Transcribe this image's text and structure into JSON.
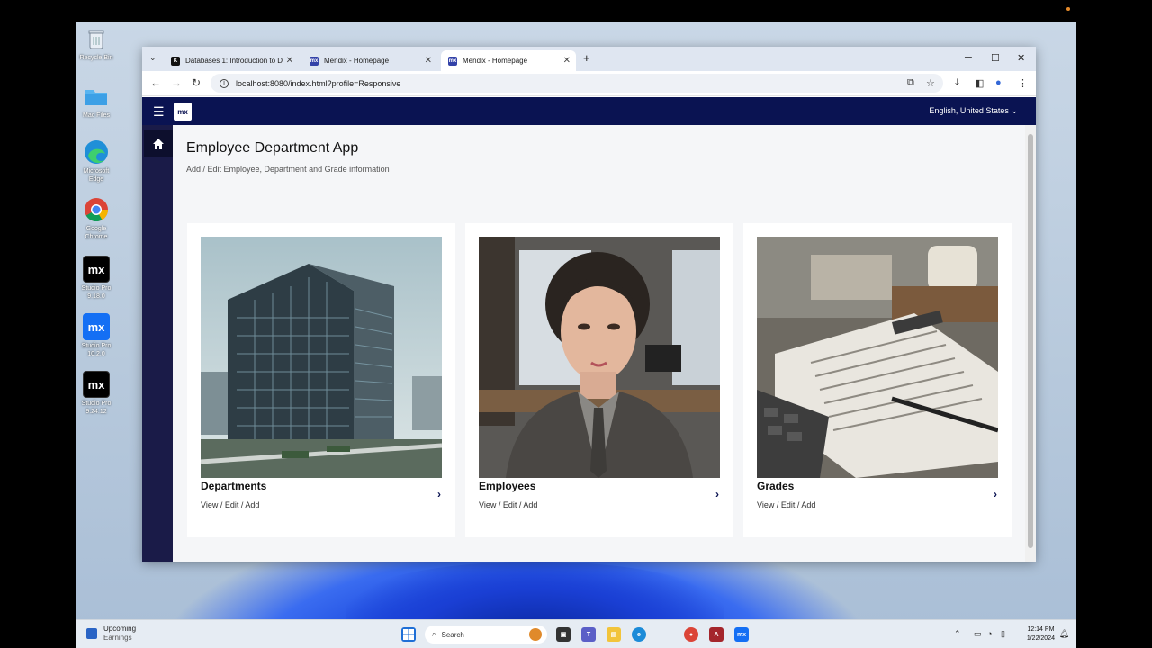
{
  "desktop": {
    "icons": [
      {
        "label": "Recycle Bin",
        "icon": "recycle-bin-icon"
      },
      {
        "label": "Mac Files",
        "icon": "folder-icon"
      },
      {
        "label": "Microsoft\nEdge",
        "icon": "edge-icon"
      },
      {
        "label": "Google\nChrome",
        "icon": "chrome-icon"
      },
      {
        "label": "Studio Pro\n9.18.0",
        "icon": "mx-icon",
        "glyph": "mx"
      },
      {
        "label": "Studio Pro\n10.2.0",
        "icon": "mx-icon",
        "glyph": "mx"
      },
      {
        "label": "Studio Pro\n9.24.12",
        "icon": "mx-icon",
        "glyph": "mx"
      }
    ]
  },
  "browser": {
    "tabs": [
      {
        "title": "Databases 1: Introduction to D",
        "favicon": "K",
        "active": false
      },
      {
        "title": "Mendix - Homepage",
        "favicon": "mx",
        "active": false
      },
      {
        "title": "Mendix - Homepage",
        "favicon": "mx",
        "active": true
      }
    ],
    "new_tab": "+",
    "url": "localhost:8080/index.html?profile=Responsive"
  },
  "app": {
    "logo": "mx",
    "language": "English, United States",
    "page_title": "Employee Department App",
    "page_subtitle": "Add / Edit Employee, Department and Grade information",
    "cards": [
      {
        "title": "Departments",
        "subtitle": "View / Edit / Add",
        "image": "building-image"
      },
      {
        "title": "Employees",
        "subtitle": "View / Edit / Add",
        "image": "employee-portrait-image"
      },
      {
        "title": "Grades",
        "subtitle": "View / Edit / Add",
        "image": "payslip-image"
      }
    ]
  },
  "taskbar": {
    "weather_title": "Upcoming",
    "weather_sub": "Earnings",
    "search_placeholder": "Search",
    "time": "12:14 PM",
    "date": "1/22/2024"
  }
}
